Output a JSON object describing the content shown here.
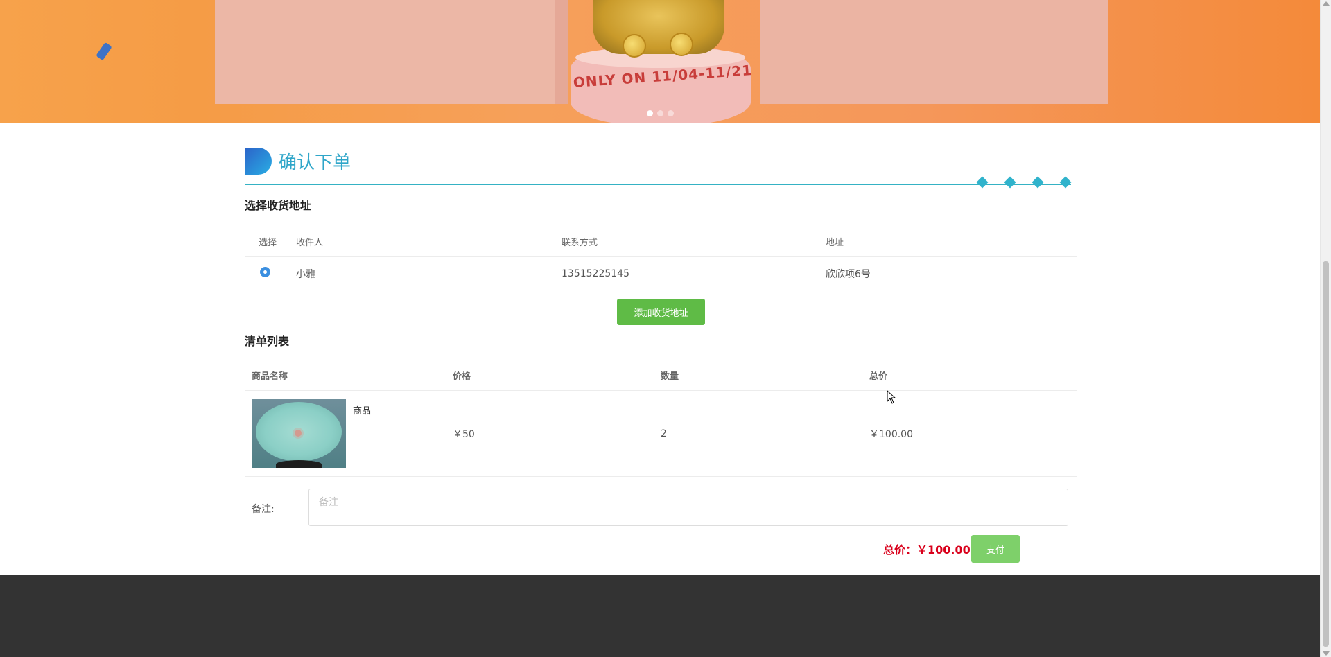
{
  "banner": {
    "promo_text": "ONLY ON 11/04-11/21",
    "slides": 3,
    "active_slide": 1
  },
  "page": {
    "title": "确认下单"
  },
  "address_section": {
    "heading": "选择收货地址",
    "columns": [
      "选择",
      "收件人",
      "联系方式",
      "地址"
    ],
    "rows": [
      {
        "selected": true,
        "recipient": "小雅",
        "phone": "13515225145",
        "address": "欣欣项6号"
      }
    ],
    "add_button_label": "添加收货地址"
  },
  "list_section": {
    "heading": "清单列表",
    "columns": [
      "商品名称",
      "价格",
      "数量",
      "总价"
    ],
    "rows": [
      {
        "name": "商品",
        "price": "￥50",
        "quantity": "2",
        "subtotal": "￥100.00"
      }
    ]
  },
  "remark": {
    "label": "备注:",
    "placeholder": "备注",
    "value": ""
  },
  "summary": {
    "total_text": "总价：￥100.00",
    "pay_button_label": "支付"
  },
  "colors": {
    "accent": "#2fa6c9",
    "add_button": "#5fbb46",
    "pay_button": "#7ed06a",
    "total": "#d9001b",
    "footer": "#333333"
  }
}
